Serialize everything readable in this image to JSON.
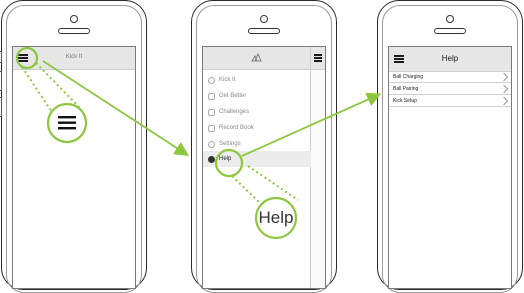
{
  "phone1": {
    "header_title": "Kick It"
  },
  "phone2": {
    "menu": [
      {
        "label": "Kick It",
        "icon": "kick-icon"
      },
      {
        "label": "Get Better",
        "icon": "chart-icon"
      },
      {
        "label": "Challenges",
        "icon": "trophy-icon"
      },
      {
        "label": "Record Book",
        "icon": "book-icon"
      },
      {
        "label": "Settings",
        "icon": "gear-icon"
      },
      {
        "label": "Help",
        "icon": "help-icon"
      }
    ],
    "callout": "Help"
  },
  "phone3": {
    "title": "Help",
    "rows": [
      "Ball Charging",
      "Ball Pairing",
      "Kick Setup"
    ]
  },
  "colors": {
    "accent_green": "#8dc63f",
    "header_gray": "#e6e6e6"
  }
}
